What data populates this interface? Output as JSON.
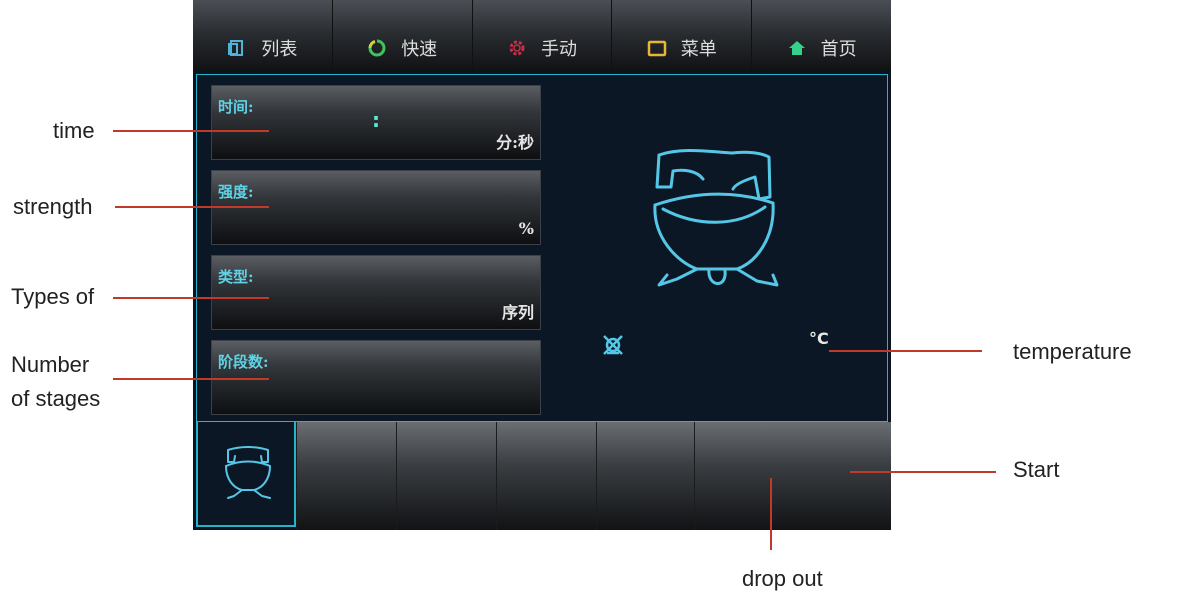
{
  "tabs": [
    {
      "label": "列表",
      "icon": "list-icon",
      "color": "#4fb3d9"
    },
    {
      "label": "快速",
      "icon": "refresh-icon",
      "color": "#3fc45a"
    },
    {
      "label": "手动",
      "icon": "gear-icon",
      "color": "#c4304a"
    },
    {
      "label": "菜单",
      "icon": "folder-icon",
      "color": "#e6b53a"
    },
    {
      "label": "首页",
      "icon": "home-icon",
      "color": "#35d08a"
    }
  ],
  "fields": {
    "time": {
      "label": "时间:",
      "colon": ":",
      "unit": "分:秒"
    },
    "strength": {
      "label": "强度:",
      "unit": "%"
    },
    "type": {
      "label": "类型:",
      "unit": "序列"
    },
    "stages": {
      "label": "阶段数:"
    }
  },
  "temperature_unit": "°C",
  "annotations": {
    "time": "time",
    "strength": "strength",
    "types_of": "Types of",
    "number_of_stages_1": "Number",
    "number_of_stages_2": "of stages",
    "temperature": "temperature",
    "start": "Start",
    "drop_out": "drop out"
  },
  "colors": {
    "accent": "#27b3c8",
    "label": "#5fd3e6",
    "annotation_line": "#c0392b"
  }
}
